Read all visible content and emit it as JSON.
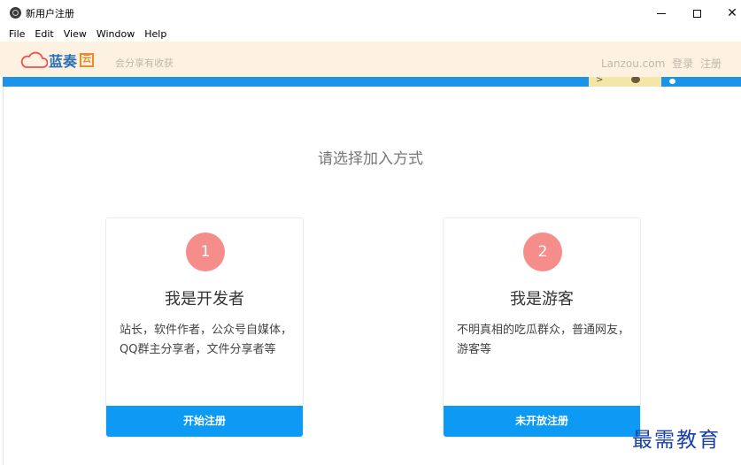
{
  "window": {
    "title": "新用户注册",
    "controls": {
      "minimize": "—",
      "maximize": "□",
      "close": "✕"
    }
  },
  "menu": [
    "File",
    "Edit",
    "View",
    "Window",
    "Help"
  ],
  "header": {
    "logo_text": "蓝奏",
    "logo_badge": "云",
    "slogan": "会分享有收获",
    "site": "Lanzou.com",
    "login": "登录",
    "register": "注册"
  },
  "main": {
    "heading": "请选择加入方式",
    "cards": [
      {
        "number": "1",
        "title": "我是开发者",
        "description": "站长，软件作者，公众号自媒体，QQ群主分享者，文件分享者等",
        "button": "开始注册"
      },
      {
        "number": "2",
        "title": "我是游客",
        "description": "不明真相的吃瓜群众，普通网友，游客等",
        "button": "未开放注册"
      }
    ]
  },
  "watermark": "最需教育",
  "colors": {
    "header_bg": "#fdf1e2",
    "banner": "#1a93e8",
    "badge": "#f58d8b",
    "button": "#0c9af5",
    "logo_blue": "#2b6fb6",
    "logo_orange": "#f08a24"
  }
}
